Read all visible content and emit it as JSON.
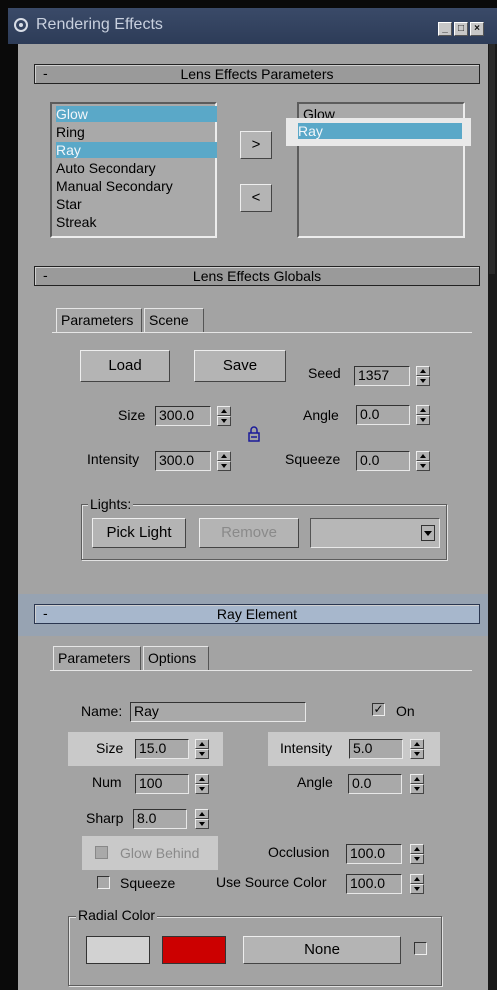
{
  "window": {
    "title": "Rendering Effects"
  },
  "lens_params": {
    "header": "Lens Effects Parameters",
    "available": [
      "Glow",
      "Ring",
      "Ray",
      "Auto Secondary",
      "Manual Secondary",
      "Star",
      "Streak"
    ],
    "selected": [
      "Glow",
      "Ray"
    ],
    "add_label": ">",
    "remove_label": "<"
  },
  "globals": {
    "header": "Lens Effects Globals",
    "tabs": [
      "Parameters",
      "Scene"
    ],
    "load": "Load",
    "save": "Save",
    "seed_label": "Seed",
    "seed": "1357",
    "size_label": "Size",
    "size": "300.0",
    "angle_label": "Angle",
    "angle": "0.0",
    "intensity_label": "Intensity",
    "intensity": "300.0",
    "squeeze_label": "Squeeze",
    "squeeze": "0.0",
    "lights_legend": "Lights:",
    "pick_light": "Pick Light",
    "remove": "Remove",
    "lights_dropdown": ""
  },
  "ray": {
    "header": "Ray Element",
    "tabs": [
      "Parameters",
      "Options"
    ],
    "name_label": "Name:",
    "name": "Ray",
    "on_label": "On",
    "on_checked": true,
    "size_label": "Size",
    "size": "15.0",
    "intensity_label": "Intensity",
    "intensity": "5.0",
    "num_label": "Num",
    "num": "100",
    "angle_label": "Angle",
    "angle": "0.0",
    "sharp_label": "Sharp",
    "sharp": "8.0",
    "glow_behind_label": "Glow Behind",
    "occlusion_label": "Occlusion",
    "occlusion": "100.0",
    "squeeze_label": "Squeeze",
    "use_source_color_label": "Use Source Color",
    "use_source_color": "100.0",
    "radial_color_legend": "Radial Color",
    "radial_color_1": "#d2d2d2",
    "radial_color_2": "#cc0000",
    "none_label": "None"
  }
}
